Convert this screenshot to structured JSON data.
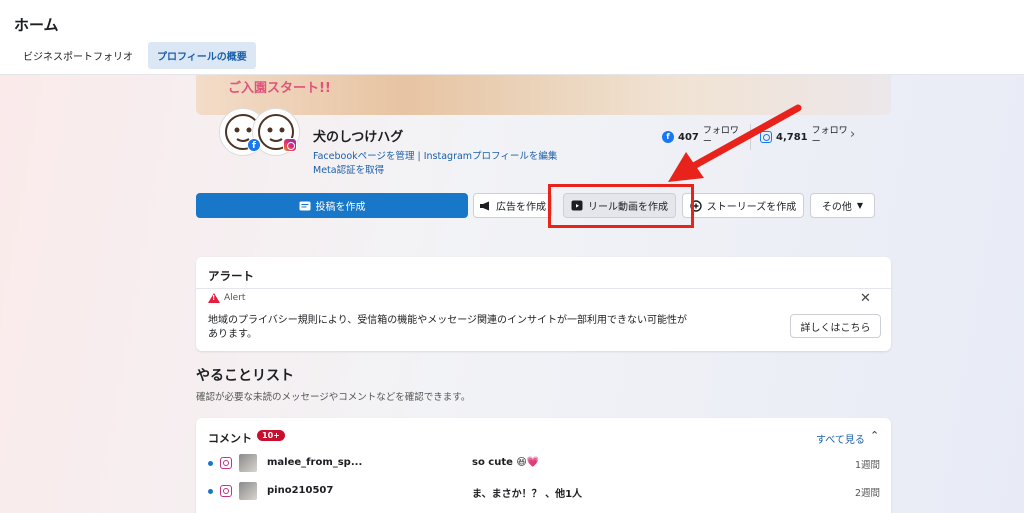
{
  "header": {
    "title": "ホーム",
    "tabs": [
      {
        "label": "ビジネスポートフォリオ",
        "active": false
      },
      {
        "label": "プロフィールの概要",
        "active": true
      }
    ]
  },
  "cover": {
    "text": "ご入園スタート!!"
  },
  "profile": {
    "name": "犬のしつけハグ",
    "links": {
      "facebook_manage": "Facebookページを管理",
      "separator": "|",
      "instagram_edit": "Instagramプロフィールを編集",
      "meta_verified": "Meta認証を取得"
    },
    "stats": [
      {
        "platform": "facebook",
        "count": "407",
        "label": "フォロワー"
      },
      {
        "platform": "instagram",
        "count": "4,781",
        "label": "フォロワー"
      }
    ]
  },
  "actions": {
    "create_post": "投稿を作成",
    "create_ad": "広告を作成",
    "create_reel": "リール動画を作成",
    "create_story": "ストーリーズを作成",
    "more": "その他"
  },
  "alert_card": {
    "title": "アラート",
    "label": "Alert",
    "message": "地域のプライバシー規則により、受信箱の機能やメッセージ関連のインサイトが一部利用できない可能性があります。",
    "button": "詳しくはこちら"
  },
  "todo": {
    "title": "やることリスト",
    "subtitle": "確認が必要な未読のメッセージやコメントなどを確認できます。"
  },
  "comments": {
    "title": "コメント",
    "badge": "10+",
    "see_all": "すべて見る",
    "rows": [
      {
        "user": "malee_from_sp...",
        "text": "so cute 😆💗",
        "time": "1週間"
      },
      {
        "user": "pino210507",
        "text": "ま、まさか！？ 、他1人",
        "time": "2週間"
      }
    ]
  },
  "colors": {
    "primary": "#1877c8",
    "annotation_red": "#e7231b",
    "alert_red": "#e41e3f",
    "link_blue": "#1b5fa8"
  }
}
